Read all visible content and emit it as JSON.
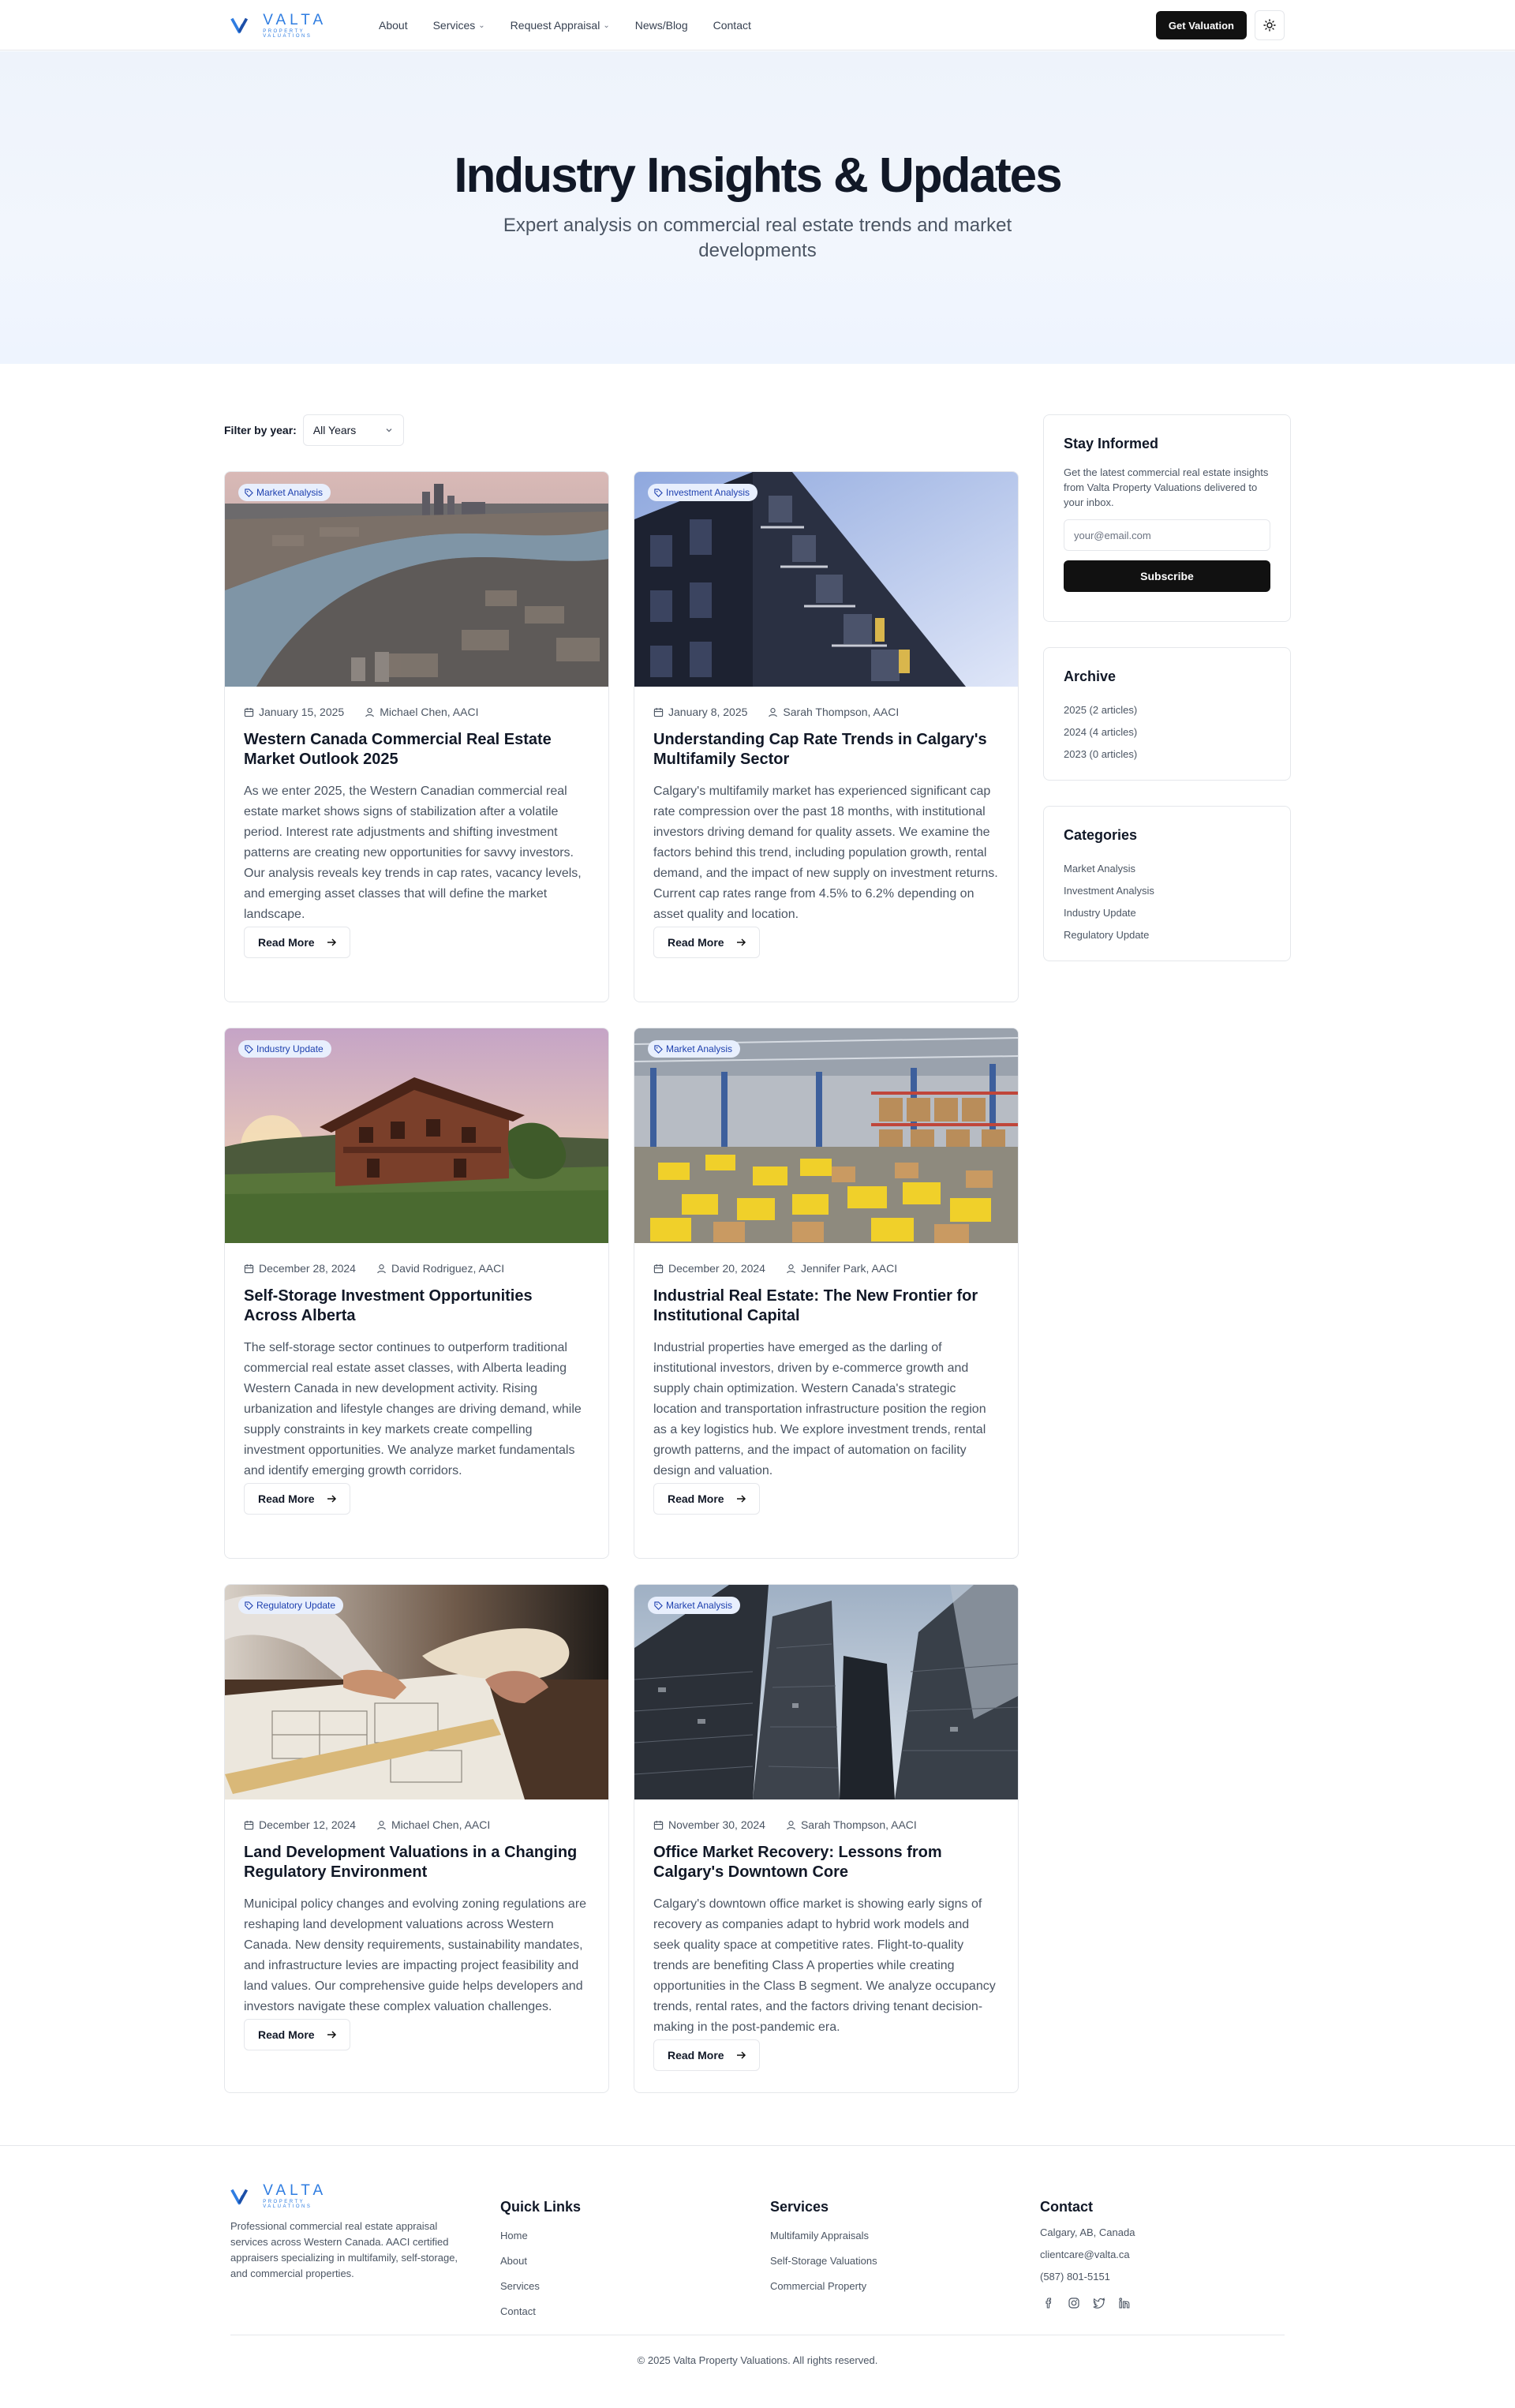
{
  "brand": {
    "name": "VALTA",
    "tagline": "PROPERTY VALUATIONS",
    "color": "#2f7de1"
  },
  "nav": {
    "items": [
      {
        "label": "About"
      },
      {
        "label": "Services"
      },
      {
        "label": "Request Appraisal"
      },
      {
        "label": "News/Blog"
      },
      {
        "label": "Contact"
      }
    ],
    "cta": "Get Valuation",
    "theme_icon": "sun-icon"
  },
  "hero": {
    "title": "Industry Insights & Updates",
    "subtitle": "Expert analysis on commercial real estate trends and market developments"
  },
  "filter": {
    "label": "Filter by year:",
    "value": "All Years"
  },
  "articles": [
    {
      "tag": "Market Analysis",
      "date": "January 15, 2025",
      "author": "Michael Chen, AACI",
      "title": "Western Canada Commercial Real Estate Market Outlook 2025",
      "excerpt": "As we enter 2025, the Western Canadian commercial real estate market shows signs of stabilization after a volatile period. Interest rate adjustments and shifting investment patterns are creating new opportunities for savvy investors. Our analysis reveals key trends in cap rates, vacancy levels, and emerging asset classes that will define the market landscape.",
      "cta": "Read More",
      "image": "city-river-aerial"
    },
    {
      "tag": "Investment Analysis",
      "date": "January 8, 2025",
      "author": "Sarah Thompson, AACI",
      "title": "Understanding Cap Rate Trends in Calgary's Multifamily Sector",
      "excerpt": "Calgary's multifamily market has experienced significant cap rate compression over the past 18 months, with institutional investors driving demand for quality assets. We examine the factors behind this trend, including population growth, rental demand, and the impact of new supply on investment returns. Current cap rates range from 4.5% to 6.2% depending on asset quality and location.",
      "cta": "Read More",
      "image": "apartment-building"
    },
    {
      "tag": "Industry Update",
      "date": "December 28, 2024",
      "author": "David Rodriguez, AACI",
      "title": "Self-Storage Investment Opportunities Across Alberta",
      "excerpt": "The self-storage sector continues to outperform traditional commercial real estate asset classes, with Alberta leading Western Canada in new development activity. Rising urbanization and lifestyle changes are driving demand, while supply constraints in key markets create compelling investment opportunities. We analyze market fundamentals and identify emerging growth corridors.",
      "cta": "Read More",
      "image": "house-sunset"
    },
    {
      "tag": "Market Analysis",
      "date": "December 20, 2024",
      "author": "Jennifer Park, AACI",
      "title": "Industrial Real Estate: The New Frontier for Institutional Capital",
      "excerpt": "Industrial properties have emerged as the darling of institutional investors, driven by e-commerce growth and supply chain optimization. Western Canada's strategic location and transportation infrastructure position the region as a key logistics hub. We explore investment trends, rental growth patterns, and the impact of automation on facility design and valuation.",
      "cta": "Read More",
      "image": "warehouse"
    },
    {
      "tag": "Regulatory Update",
      "date": "December 12, 2024",
      "author": "Michael Chen, AACI",
      "title": "Land Development Valuations in a Changing Regulatory Environment",
      "excerpt": "Municipal policy changes and evolving zoning regulations are reshaping land development valuations across Western Canada. New density requirements, sustainability mandates, and infrastructure levies are impacting project feasibility and land values. Our comprehensive guide helps developers and investors navigate these complex valuation challenges.",
      "cta": "Read More",
      "image": "blueprints"
    },
    {
      "tag": "Market Analysis",
      "date": "November 30, 2024",
      "author": "Sarah Thompson, AACI",
      "title": "Office Market Recovery: Lessons from Calgary's Downtown Core",
      "excerpt": "Calgary's downtown office market is showing early signs of recovery as companies adapt to hybrid work models and seek quality space at competitive rates. Flight-to-quality trends are benefiting Class A properties while creating opportunities in the Class B segment. We analyze occupancy trends, rental rates, and the factors driving tenant decision-making in the post-pandemic era.",
      "cta": "Read More",
      "image": "office-towers"
    }
  ],
  "sidebar": {
    "newsletter": {
      "title": "Stay Informed",
      "text": "Get the latest commercial real estate insights from Valta Property Valuations delivered to your inbox.",
      "placeholder": "your@email.com",
      "button": "Subscribe"
    },
    "archive": {
      "title": "Archive",
      "items": [
        "2025 (2 articles)",
        "2024 (4 articles)",
        "2023 (0 articles)"
      ]
    },
    "categories": {
      "title": "Categories",
      "items": [
        "Market Analysis",
        "Investment Analysis",
        "Industry Update",
        "Regulatory Update"
      ]
    }
  },
  "footer": {
    "description": "Professional commercial real estate appraisal services across Western Canada. AACI certified appraisers specializing in multifamily, self-storage, and commercial properties.",
    "quick_links": {
      "title": "Quick Links",
      "items": [
        "Home",
        "About",
        "Services",
        "Contact"
      ]
    },
    "services": {
      "title": "Services",
      "items": [
        "Multifamily Appraisals",
        "Self-Storage Valuations",
        "Commercial Property"
      ]
    },
    "contact": {
      "title": "Contact",
      "items": [
        "Calgary, AB, Canada",
        "clientcare@valta.ca",
        "(587) 801-5151"
      ]
    },
    "social": [
      "facebook-icon",
      "instagram-icon",
      "twitter-icon",
      "linkedin-icon"
    ],
    "copyright": "© 2025 Valta Property Valuations. All rights reserved."
  }
}
